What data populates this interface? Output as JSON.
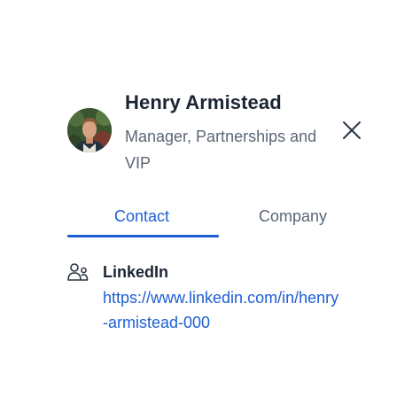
{
  "profile": {
    "name": "Henry Armistead",
    "title_line1": "Manager, Partnerships and",
    "title_line2": "VIP"
  },
  "tabs": [
    {
      "label": "Contact",
      "active": true
    },
    {
      "label": "Company",
      "active": false
    }
  ],
  "contact": {
    "linkedin_label": "LinkedIn",
    "linkedin_url_line1": "https://www.linkedin.com/in/henry",
    "linkedin_url_line2": "-armistead-000"
  },
  "colors": {
    "accent": "#1e5fd4",
    "heading": "#1b2432",
    "muted": "#5b6676"
  },
  "icons": {
    "close": "close-icon",
    "linkedin": "user-group-icon"
  }
}
